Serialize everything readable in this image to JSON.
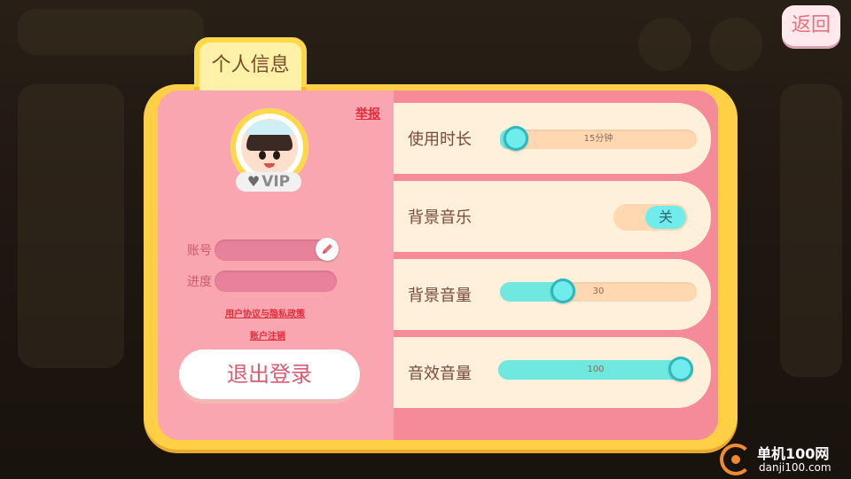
{
  "header": {
    "back_label": "返回"
  },
  "tab": {
    "title": "个人信息"
  },
  "profile": {
    "report_label": "举报",
    "vip_label": "VIP",
    "account_label": "账号",
    "account_value": "",
    "progress_label": "进度",
    "progress_value": "",
    "policy_link": "用户协议与隐私政策",
    "cancel_account_link": "账户注销",
    "logout_label": "退出登录"
  },
  "settings": {
    "usage_time": {
      "label": "使用时长",
      "value_text": "15分钟",
      "fill": 0.08
    },
    "bg_music": {
      "label": "背景音乐",
      "toggle_label": "关",
      "on": false
    },
    "bg_volume": {
      "label": "背景音量",
      "value_text": "30",
      "fill": 0.32
    },
    "sfx_volume": {
      "label": "音效音量",
      "value_text": "100",
      "fill": 1.0
    }
  },
  "watermark": {
    "name": "单机100网",
    "url": "danji100.com"
  },
  "colors": {
    "accent": "#ffcf45",
    "panel": "#f68f9c",
    "slider_fill": "#6fe8e0",
    "link": "#e52a3a"
  }
}
